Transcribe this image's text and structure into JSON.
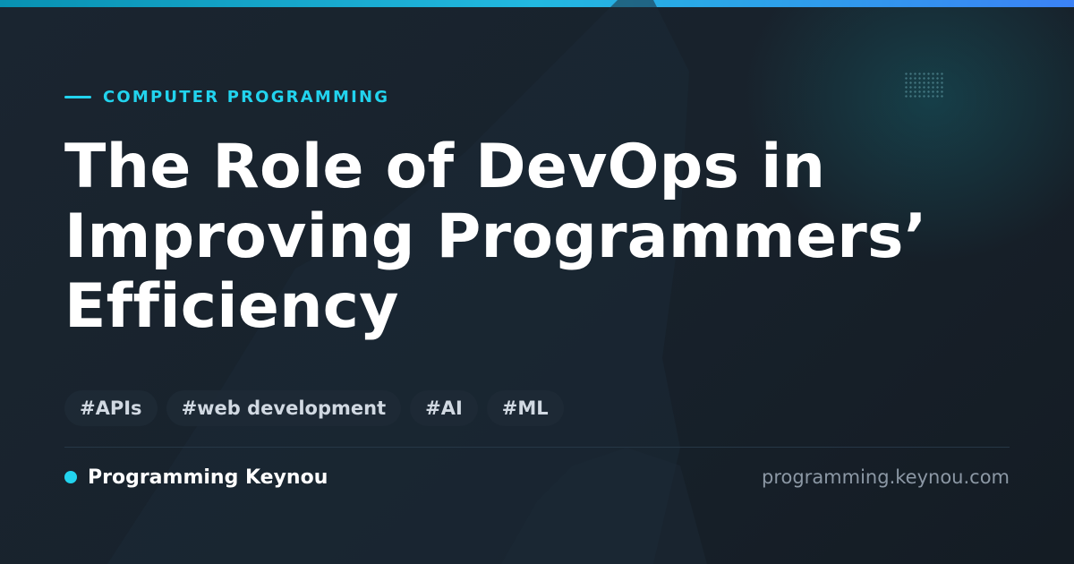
{
  "header": {
    "category": "COMPUTER PROGRAMMING",
    "title": "The Role of DevOps in Improving Programmers’ Efficiency"
  },
  "tags": [
    "#APIs",
    "#web development",
    "#AI",
    "#ML"
  ],
  "footer": {
    "brand": "Programming Keynou",
    "domain": "programming.keynou.com"
  },
  "colors": {
    "accent": "#22d3ee",
    "background": "#18222c",
    "title_text": "#ffffff",
    "tag_text": "#d1d9e2",
    "domain_text": "#8c98a5"
  },
  "icons": {
    "category_marker": "dash-line-icon",
    "brand_marker": "dot-icon"
  }
}
